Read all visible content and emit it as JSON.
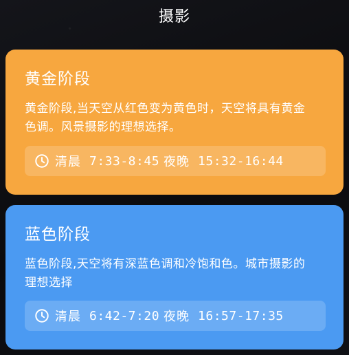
{
  "header": {
    "title": "摄影"
  },
  "cards": [
    {
      "title": "黄金阶段",
      "description": "黄金阶段,当天空从红色变为黄色时，天空将具有黄金色调。风景摄影的理想选择。",
      "morning_label": "清晨",
      "morning_range": "7:33-8:45",
      "evening_label": "夜晚",
      "evening_range": "15:32-16:44",
      "color": "#f7a73f"
    },
    {
      "title": "蓝色阶段",
      "description": "蓝色阶段,天空将有深蓝色调和冷饱和色。城市摄影的理想选择",
      "morning_label": "清晨",
      "morning_range": "6:42-7:20",
      "evening_label": "夜晚",
      "evening_range": "16:57-17:35",
      "color": "#4b9af2"
    }
  ],
  "icons": {
    "time": "clock-icon"
  }
}
